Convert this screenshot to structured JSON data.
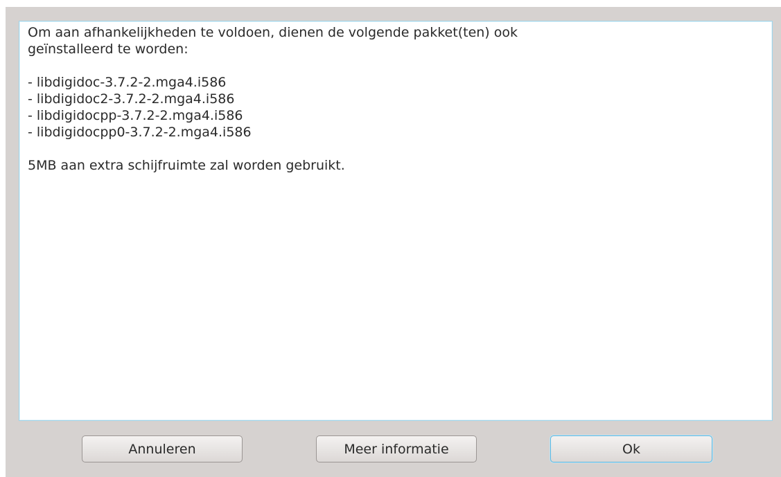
{
  "message": {
    "lines": [
      "Om aan afhankelijkheden te voldoen, dienen de volgende pakket(ten) ook",
      "geïnstalleerd te worden:",
      "",
      "- libdigidoc-3.7.2-2.mga4.i586",
      "- libdigidoc2-3.7.2-2.mga4.i586",
      "- libdigidocpp-3.7.2-2.mga4.i586",
      "- libdigidocpp0-3.7.2-2.mga4.i586",
      "",
      "5MB aan extra schijfruimte zal worden gebruikt."
    ]
  },
  "buttons": {
    "cancel_label": "Annuleren",
    "info_label": "Meer informatie",
    "ok_label": "Ok"
  },
  "colors": {
    "dialog_background": "#d6d2d0",
    "focus_accent": "#5fb8e0"
  }
}
